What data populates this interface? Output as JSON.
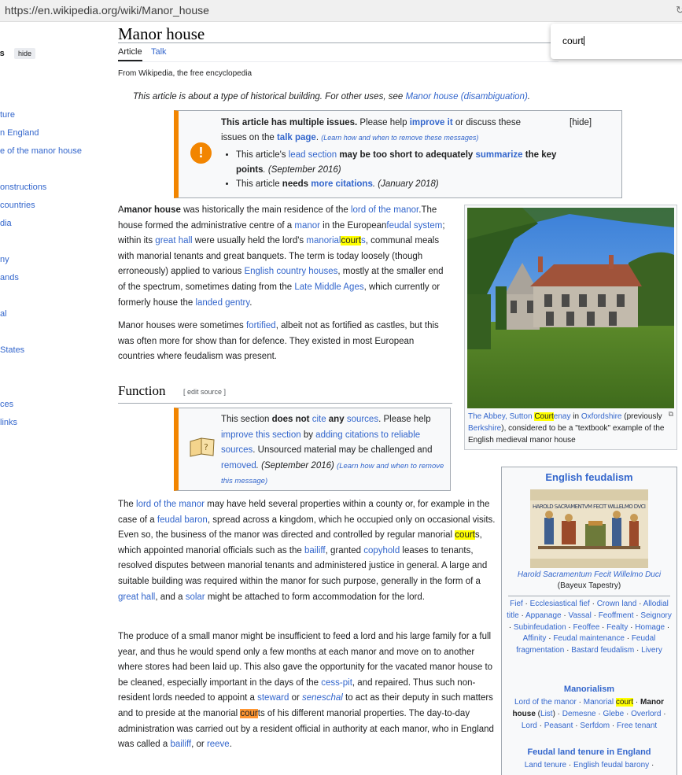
{
  "browser": {
    "url": "https://en.wikipedia.org/wiki/Manor_house"
  },
  "find": {
    "query": "court"
  },
  "sidebar": {
    "heading": "ts",
    "hide_label": "hide",
    "items": [
      "ture",
      "n England",
      "e of the manor house",
      "onstructions",
      "countries",
      "dia",
      "ny",
      "ands",
      "al",
      "States",
      "ces",
      "links"
    ]
  },
  "page": {
    "title": "Manor house",
    "tabs": [
      "Article",
      "Talk"
    ],
    "from_wiki": "From Wikipedia, the free encyclopedia",
    "hatnote": {
      "text": "This article is about a type of historical building. For other uses, see ",
      "link": "Manor house (disambiguation)",
      "end": "."
    }
  },
  "issues": {
    "hide": "[hide]",
    "l1a": "This article has multiple issues.",
    "l1b": " Please help ",
    "l1c": "improve it",
    "l1d": " or discuss these",
    "l2a": "issues on the ",
    "l2b": "talk page",
    "l2c": ". ",
    "l2d": "(Learn how and when to remove these messages)",
    "b1a": "This article's ",
    "b1b": "lead section",
    "b1c": " may be too short to adequately ",
    "b1d": "summarize",
    "b1e": " the key",
    "b1f": "points",
    "b1g": ". (September 2016)",
    "b2a": "This article ",
    "b2b": "needs",
    "b2c": " more citations",
    "b2d": ". (January 2018)"
  },
  "lead": {
    "p1": [
      [
        "A",
        "",
        "t"
      ],
      [
        "manor house",
        "",
        "b"
      ],
      [
        " was historically the main residence of the ",
        "",
        "t"
      ],
      [
        "lord of the manor",
        "",
        "a"
      ],
      [
        ".",
        "",
        "t"
      ],
      [
        "The house formed the administrative centre of a ",
        "",
        "t"
      ],
      [
        "manor",
        "",
        "a"
      ],
      [
        " in the European",
        "",
        "t"
      ],
      [
        "feudal system",
        "",
        "a"
      ],
      [
        "; within its ",
        "",
        "t"
      ],
      [
        "great hall",
        "",
        "a"
      ],
      [
        " were usually held the lord's ",
        "",
        "t"
      ],
      [
        "manorial",
        "",
        "a"
      ],
      [
        "court",
        "",
        "h"
      ],
      [
        "s",
        "",
        "a"
      ],
      [
        ", communal meals with manorial tenants and great banquets. The term is today loosely (though erroneously) applied to various ",
        "",
        "t"
      ],
      [
        "English country houses",
        "",
        "a"
      ],
      [
        ", mostly at the smaller end of the spectrum, sometimes dating from the ",
        "",
        "t"
      ],
      [
        "Late Middle Ages",
        "",
        "a"
      ],
      [
        ", which currently or formerly house the ",
        "",
        "t"
      ],
      [
        "landed gentry",
        "",
        "a"
      ],
      [
        ".",
        "",
        "t"
      ]
    ],
    "p2": [
      [
        "Manor houses were sometimes ",
        "",
        "t"
      ],
      [
        "fortified",
        "",
        "a"
      ],
      [
        ", albeit not as fortified as castles, but this was often more for show than for defence. They existed in most European countries where feudalism was present.",
        "",
        "t"
      ]
    ]
  },
  "function": {
    "heading": "Function",
    "edit": "[ edit source ]",
    "box": [
      [
        "This section ",
        "",
        "t"
      ],
      [
        "does not ",
        "",
        "b"
      ],
      [
        "cite",
        "",
        "a"
      ],
      [
        " any ",
        "",
        "b"
      ],
      [
        "sources",
        "",
        "a"
      ],
      [
        ". Please help ",
        "",
        "t"
      ],
      [
        "improve this section",
        "",
        "a"
      ],
      [
        " by ",
        "",
        "t"
      ],
      [
        "adding citations to reliable sources",
        "",
        "a"
      ],
      [
        ". Unsourced material may be challenged and ",
        "",
        "t"
      ],
      [
        "removed",
        "",
        "a"
      ],
      [
        ". (September 2016) ",
        "",
        "i"
      ],
      [
        "(Learn how and when to remove this message)",
        "",
        "s"
      ]
    ],
    "p1": [
      [
        "The ",
        "",
        "t"
      ],
      [
        "lord of the manor",
        "",
        "a"
      ],
      [
        " may have held several properties within a county or, for example in the case of a ",
        "",
        "t"
      ],
      [
        "feudal baron",
        "",
        "a"
      ],
      [
        ", spread across a kingdom, which he occupied only on occasional visits. Even so, the business of the manor was directed and controlled by regular manorial ",
        "",
        "t"
      ],
      [
        "court",
        "",
        "h"
      ],
      [
        "s, which appointed manorial officials such as the ",
        "",
        "t"
      ],
      [
        "bailiff",
        "",
        "a"
      ],
      [
        ", granted ",
        "",
        "t"
      ],
      [
        "copyhold",
        "",
        "a"
      ],
      [
        " leases to tenants, resolved disputes between manorial tenants and administered justice in general. A large and suitable building was required within the manor for such purpose, generally in the form of a ",
        "",
        "t"
      ],
      [
        "great hall",
        "",
        "a"
      ],
      [
        ", and a ",
        "",
        "t"
      ],
      [
        "solar",
        "",
        "a"
      ],
      [
        " might be attached to form accommodation for the lord.",
        "",
        "t"
      ]
    ],
    "p2": [
      [
        "The produce of a small manor might be insufficient to feed a lord and his large family for a full year, and thus he would spend only a few months at each manor and move on to another where stores had been laid up. This also gave the opportunity for the vacated manor house to be cleaned, especially important in the days of the ",
        "",
        "t"
      ],
      [
        "cess-pit",
        "",
        "a"
      ],
      [
        ", and repaired. Thus such non-resident lords needed to appoint a ",
        "",
        "t"
      ],
      [
        "steward",
        "",
        "a"
      ],
      [
        " or ",
        "",
        "t"
      ],
      [
        "seneschal",
        "",
        "ai"
      ],
      [
        " to act as their deputy in such matters and to preside at the manorial ",
        "",
        "t"
      ],
      [
        "cour",
        "",
        "c"
      ],
      [
        "t",
        "",
        "t"
      ],
      [
        "s of his different manorial properties. The day-to-day administration was carried out by a resident official in authority at each manor, who in England was called a ",
        "",
        "t"
      ],
      [
        "bailiff",
        "",
        "a"
      ],
      [
        ", or ",
        "",
        "t"
      ],
      [
        "reeve",
        "",
        "a"
      ],
      [
        ".",
        "",
        "t"
      ]
    ]
  },
  "figure": {
    "caption": [
      [
        "The Abbey",
        "",
        "a"
      ],
      [
        ", Sutton ",
        "",
        "a"
      ],
      [
        "Court",
        "",
        "h"
      ],
      [
        "enay",
        "",
        "a"
      ],
      [
        " in ",
        "",
        "t"
      ],
      [
        "Oxfordshire",
        "",
        "a"
      ],
      [
        " (previously ",
        "",
        "t"
      ],
      [
        "Berkshire",
        "",
        "a"
      ],
      [
        "), considered to be a \"textbook\" example of the English medieval manor house",
        "",
        "t"
      ]
    ]
  },
  "infobox": {
    "title": "English feudalism",
    "tapestry_text": "HAROLD SACRAMENTVM FECIT WILLELMO DVCI",
    "img_caption_italic": "Harold Sacramentum Fecit Willelmo Duci",
    "img_caption_paren": "(Bayeux Tapestry)",
    "group1": [
      [
        "Fief",
        "",
        "a"
      ],
      [
        " · ",
        "",
        "t"
      ],
      [
        "Ecclesiastical fief",
        "",
        "a"
      ],
      [
        " · ",
        "",
        "t"
      ],
      [
        "Crown land",
        "",
        "a"
      ],
      [
        " · ",
        "",
        "t"
      ],
      [
        "Allodial title",
        "",
        "a"
      ],
      [
        " · ",
        "",
        "t"
      ],
      [
        "Appanage",
        "",
        "a"
      ],
      [
        " · ",
        "",
        "t"
      ],
      [
        "Vassal",
        "",
        "a"
      ],
      [
        " · ",
        "",
        "t"
      ],
      [
        "Feoffment",
        "",
        "a"
      ],
      [
        " · ",
        "",
        "t"
      ],
      [
        "Seignory",
        "",
        "a"
      ],
      [
        " · ",
        "",
        "t"
      ],
      [
        "Subinfeudation",
        "",
        "a"
      ],
      [
        " · ",
        "",
        "t"
      ],
      [
        "Feoffee",
        "",
        "a"
      ],
      [
        " · ",
        "",
        "t"
      ],
      [
        "Fealty",
        "",
        "a"
      ],
      [
        " · ",
        "",
        "t"
      ],
      [
        "Homage",
        "",
        "a"
      ],
      [
        " · ",
        "",
        "t"
      ],
      [
        "Affinity",
        "",
        "a"
      ],
      [
        " · ",
        "",
        "t"
      ],
      [
        "Feudal maintenance",
        "",
        "a"
      ],
      [
        " · ",
        "",
        "t"
      ],
      [
        "Feudal fragmentation",
        "",
        "a"
      ],
      [
        " · ",
        "",
        "t"
      ],
      [
        "Bastard feudalism",
        "",
        "a"
      ],
      [
        " · ",
        "",
        "t"
      ],
      [
        "Livery",
        "",
        "a"
      ]
    ],
    "sub1": "Manorialism",
    "group2": [
      [
        "Lord of the manor",
        "",
        "a"
      ],
      [
        " · ",
        "",
        "t"
      ],
      [
        "Manorial ",
        "",
        "a"
      ],
      [
        "court",
        "",
        "h"
      ],
      [
        " · ",
        "",
        "t"
      ],
      [
        "Manor house",
        "",
        "b"
      ],
      [
        " (",
        "",
        "t"
      ],
      [
        "List",
        "",
        "a"
      ],
      [
        ") · ",
        "",
        "t"
      ],
      [
        "Demesne",
        "",
        "a"
      ],
      [
        " · ",
        "",
        "t"
      ],
      [
        "Glebe",
        "",
        "a"
      ],
      [
        " · ",
        "",
        "t"
      ],
      [
        "Overlord",
        "",
        "a"
      ],
      [
        " · ",
        "",
        "t"
      ],
      [
        "Lord",
        "",
        "a"
      ],
      [
        " · ",
        "",
        "t"
      ],
      [
        "Peasant",
        "",
        "a"
      ],
      [
        " · ",
        "",
        "t"
      ],
      [
        "Serfdom",
        "",
        "a"
      ],
      [
        " · ",
        "",
        "t"
      ],
      [
        "Free tenant",
        "",
        "a"
      ]
    ],
    "sub2": "Feudal land tenure in England",
    "group3": [
      [
        "Land tenure",
        "",
        "a"
      ],
      [
        " · ",
        "",
        "t"
      ],
      [
        "English feudal barony",
        "",
        "a"
      ],
      [
        " ·",
        "",
        "t"
      ]
    ]
  },
  "colors": {
    "link": "#3366cc",
    "highlight": "#ffff00",
    "current_match": "#ff9632",
    "ambox_border": "#f28500"
  }
}
